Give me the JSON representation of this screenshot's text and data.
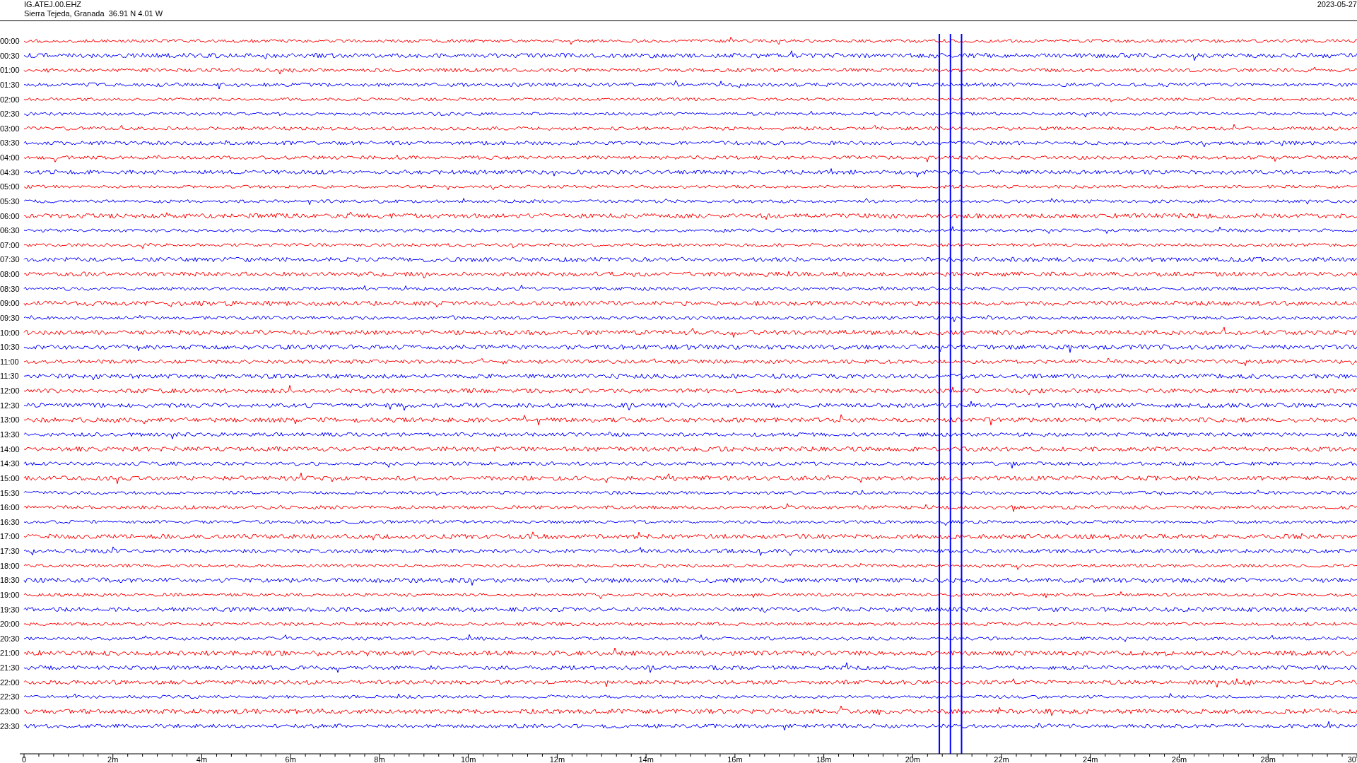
{
  "header": {
    "station": "IG.ATEJ.00.EHZ",
    "location": "Sierra Tejeda, Granada  36.91 N 4.01 W",
    "date": "2023-05-27"
  },
  "traces": [
    {
      "time": "00:00",
      "color": "#ff0000"
    },
    {
      "time": "00:30",
      "color": "#0000ff"
    },
    {
      "time": "01:00",
      "color": "#ff0000"
    },
    {
      "time": "01:30",
      "color": "#0000ff"
    },
    {
      "time": "02:00",
      "color": "#ff0000"
    },
    {
      "time": "02:30",
      "color": "#0000ff"
    },
    {
      "time": "03:00",
      "color": "#ff0000"
    },
    {
      "time": "03:30",
      "color": "#0000ff"
    },
    {
      "time": "04:00",
      "color": "#ff0000"
    },
    {
      "time": "04:30",
      "color": "#0000ff"
    },
    {
      "time": "05:00",
      "color": "#ff0000"
    },
    {
      "time": "05:30",
      "color": "#0000ff"
    },
    {
      "time": "06:00",
      "color": "#ff0000"
    },
    {
      "time": "06:30",
      "color": "#0000ff"
    },
    {
      "time": "07:00",
      "color": "#ff0000"
    },
    {
      "time": "07:30",
      "color": "#0000ff"
    },
    {
      "time": "08:00",
      "color": "#ff0000"
    },
    {
      "time": "08:30",
      "color": "#0000ff"
    },
    {
      "time": "09:00",
      "color": "#ff0000"
    },
    {
      "time": "09:30",
      "color": "#0000ff"
    },
    {
      "time": "10:00",
      "color": "#ff0000"
    },
    {
      "time": "10:30",
      "color": "#0000ff"
    },
    {
      "time": "11:00",
      "color": "#ff0000"
    },
    {
      "time": "11:30",
      "color": "#0000ff"
    },
    {
      "time": "12:00",
      "color": "#ff0000"
    },
    {
      "time": "12:30",
      "color": "#0000ff"
    },
    {
      "time": "13:00",
      "color": "#ff0000"
    },
    {
      "time": "13:30",
      "color": "#0000ff"
    },
    {
      "time": "14:00",
      "color": "#ff0000"
    },
    {
      "time": "14:30",
      "color": "#0000ff"
    },
    {
      "time": "15:00",
      "color": "#ff0000"
    },
    {
      "time": "15:30",
      "color": "#0000ff"
    },
    {
      "time": "16:00",
      "color": "#ff0000"
    },
    {
      "time": "16:30",
      "color": "#0000ff"
    },
    {
      "time": "17:00",
      "color": "#ff0000"
    },
    {
      "time": "17:30",
      "color": "#0000ff"
    },
    {
      "time": "18:00",
      "color": "#ff0000"
    },
    {
      "time": "18:30",
      "color": "#0000ff"
    },
    {
      "time": "19:00",
      "color": "#ff0000"
    },
    {
      "time": "19:30",
      "color": "#0000ff"
    },
    {
      "time": "20:00",
      "color": "#ff0000"
    },
    {
      "time": "20:30",
      "color": "#0000ff"
    },
    {
      "time": "21:00",
      "color": "#ff0000"
    },
    {
      "time": "21:30",
      "color": "#0000ff"
    },
    {
      "time": "22:00",
      "color": "#ff0000"
    },
    {
      "time": "22:30",
      "color": "#0000ff"
    },
    {
      "time": "23:00",
      "color": "#ff0000"
    },
    {
      "time": "23:30",
      "color": "#0000ff"
    }
  ],
  "x_axis": {
    "labels": [
      "0",
      "2m",
      "4m",
      "6m",
      "8m",
      "10m",
      "12m",
      "14m",
      "16m",
      "18m",
      "20m",
      "22m",
      "24m",
      "26m",
      "28m",
      "30"
    ]
  }
}
